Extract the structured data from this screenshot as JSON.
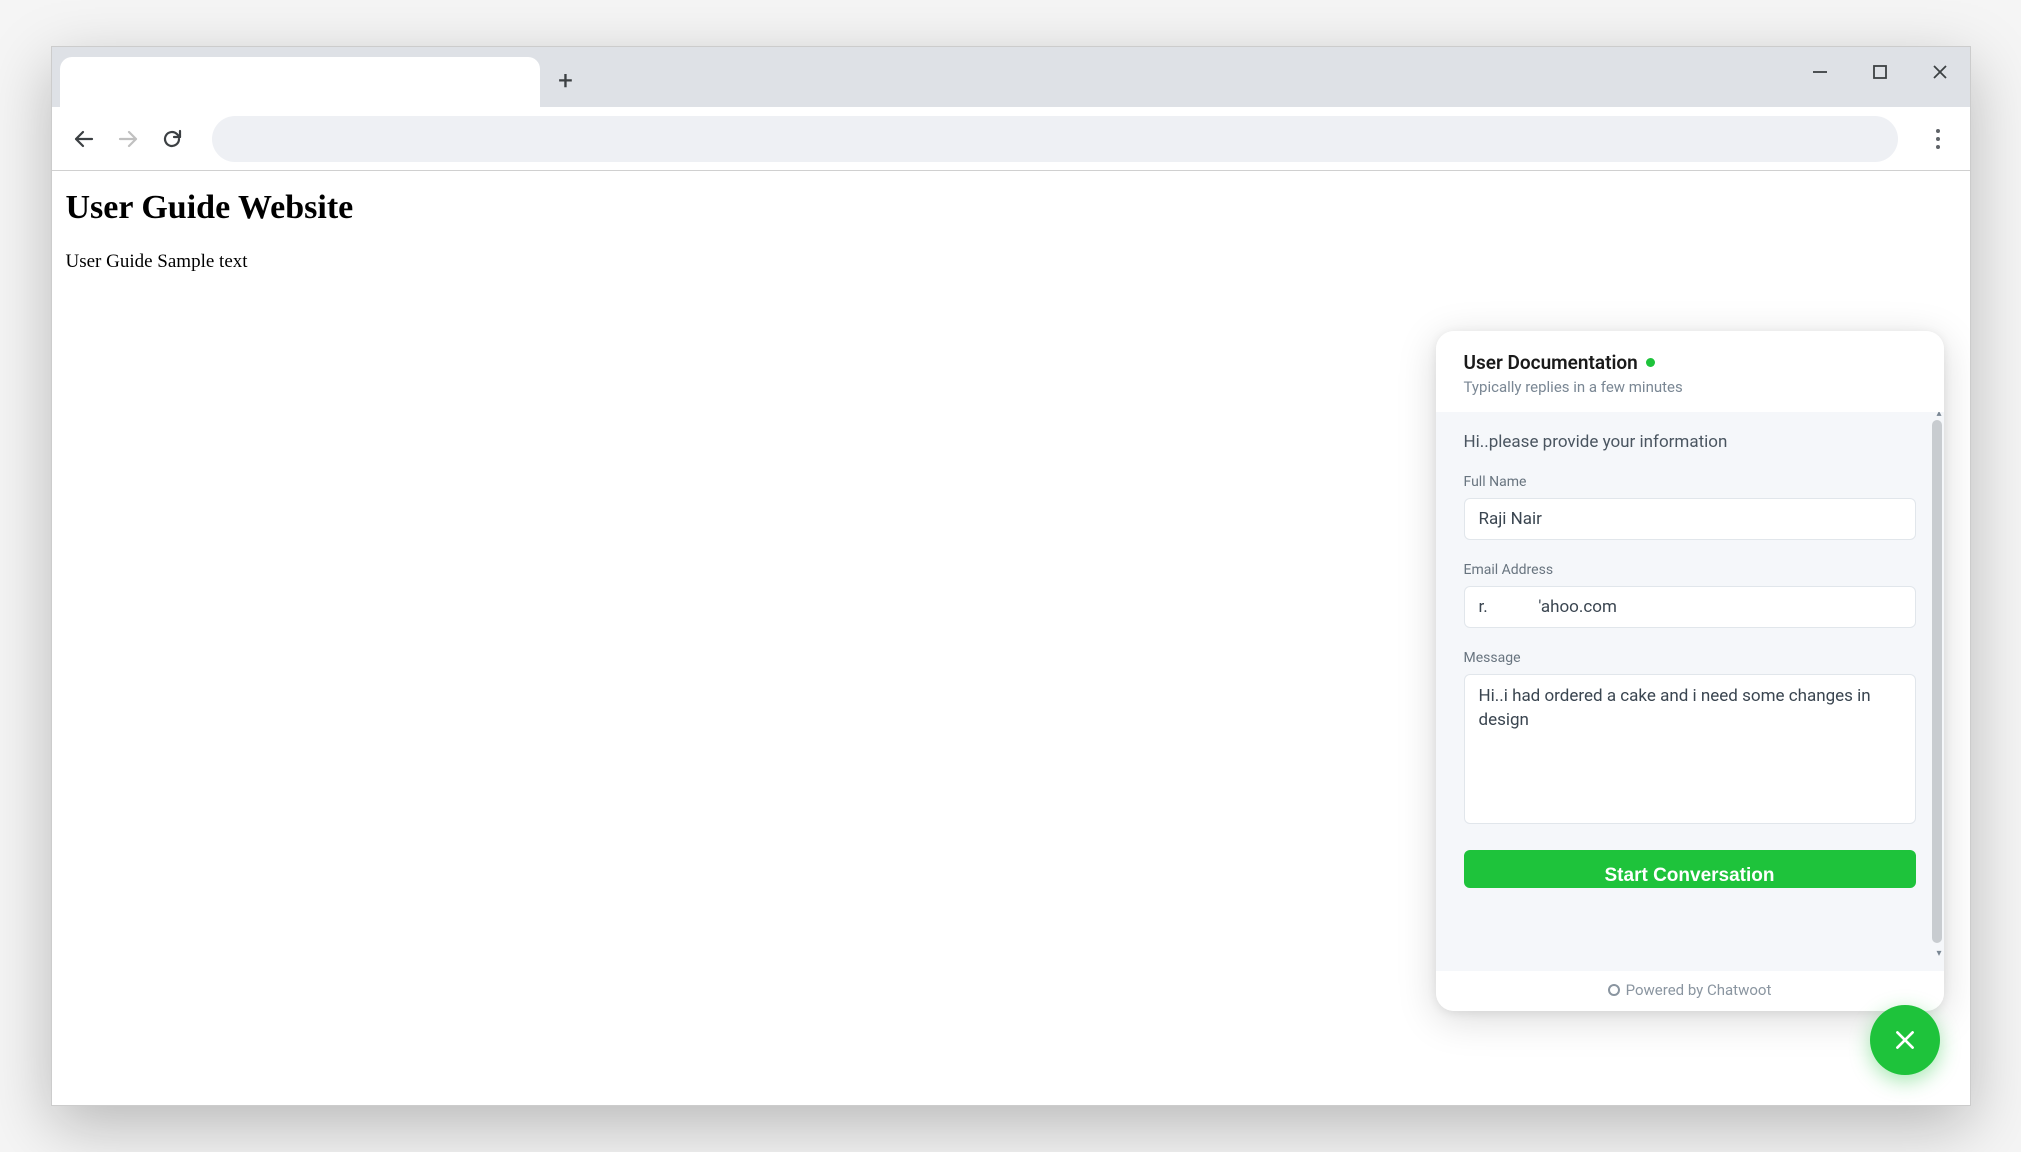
{
  "page": {
    "heading": "User Guide Website",
    "body_text": "User Guide Sample text"
  },
  "chat": {
    "title": "User Documentation",
    "subtitle": "Typically replies in a few minutes",
    "prompt": "Hi..please provide your information",
    "fields": {
      "full_name": {
        "label": "Full Name",
        "value": "Raji Nair"
      },
      "email": {
        "label": "Email Address",
        "value": "r.            'ahoo.com"
      },
      "message": {
        "label": "Message",
        "value": "Hi..i had ordered a cake and i need some changes in design"
      }
    },
    "submit_label": "Start Conversation",
    "footer": "Powered by Chatwoot"
  }
}
